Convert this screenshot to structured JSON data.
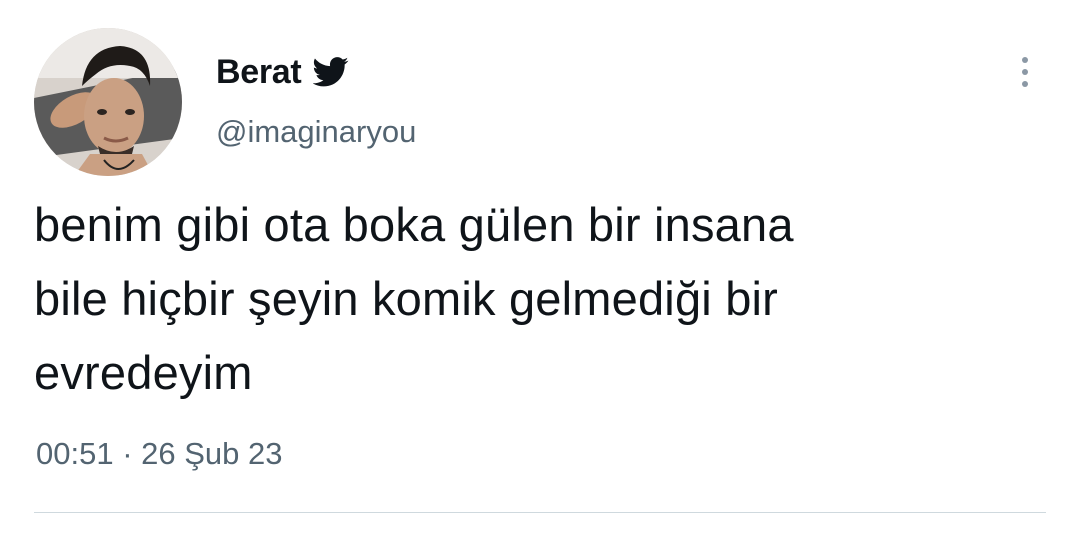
{
  "author": {
    "display_name": "Berat",
    "handle": "@imaginaryou",
    "twitter_bird_icon": "twitter-bird-icon",
    "brand_color": "#0f1419"
  },
  "tweet": {
    "lines": [
      "benim gibi ota boka gülen bir insana",
      "bile hiçbir şeyin komik gelmediği bir",
      "evredeyim"
    ],
    "time": "00:51",
    "separator": " · ",
    "date": "26 Şub 23"
  },
  "menu": {
    "icon": "more-vertical-icon"
  }
}
